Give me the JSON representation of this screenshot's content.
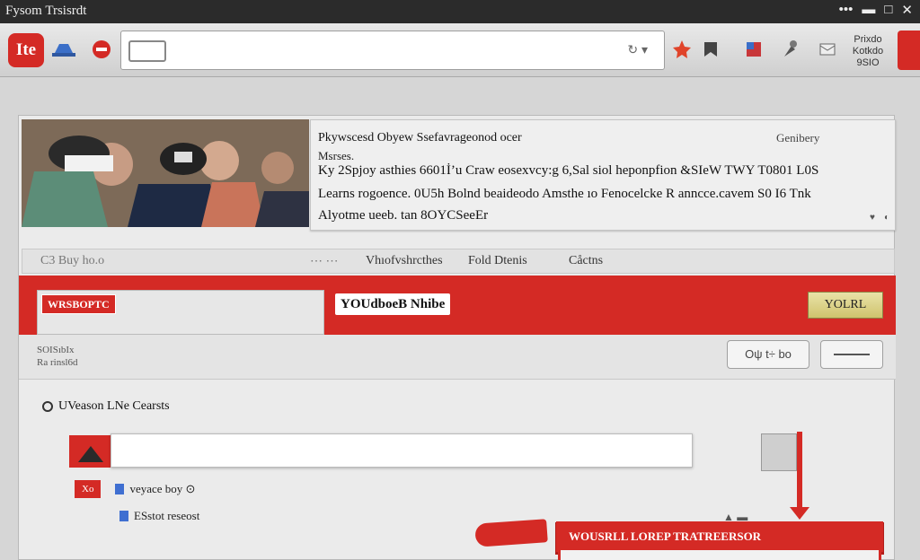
{
  "window": {
    "title": "Fysom Trsisrdt",
    "controls": [
      "•••",
      "▬",
      "□",
      "✕"
    ]
  },
  "toolbar": {
    "logo_text": "Ite",
    "right_text": "Prixdo\nKotkdo\n9SIO"
  },
  "hero": {
    "title": "Pkywscesd Obyew Ssefavrageonod ocer",
    "link": "Genibery",
    "subtitle": "Msrses.",
    "line1": "Ky 2Spjoy asthies 6601İ’u Craw eosexvcy:g 6,Sal siol heponpfion &SIeW TWY T0801 L0S",
    "line2": "Learns rogoence. 0U5h Bolnd beaideodo Amsthe ıo Fenocelcke R anncce.cavem S0 I6 Tnk",
    "line3": "Alyotme ueeb. tan 8OYCSeeEr"
  },
  "tabs": {
    "left": "C3 Buy ho.o",
    "t1": "Vhıofvshrcthes",
    "t2": "Fold Dtenis",
    "t3": "Cåctns"
  },
  "redbar": {
    "tag": "WRSBOPTC",
    "mid": "YOUdboeB Nhibe",
    "button": "YOLRL"
  },
  "subrow": {
    "small1": "SOISıbIx",
    "small2": "Ra rinsl6d",
    "pill": "Oψ t÷ bo"
  },
  "section": {
    "title": "UVeason LNe Cearsts"
  },
  "field": {
    "value": "",
    "placeholder": ""
  },
  "options": {
    "opt1_tag": "Xo",
    "opt1_label": "veyace boy ⊙",
    "opt2_label": "ESstot reseost"
  },
  "cta": {
    "label": "WOUSRLL LOREP TRATREERSOR"
  },
  "colors": {
    "accent": "#d42a25",
    "bar": "#2b2b2b",
    "panel": "#ebebeb"
  }
}
